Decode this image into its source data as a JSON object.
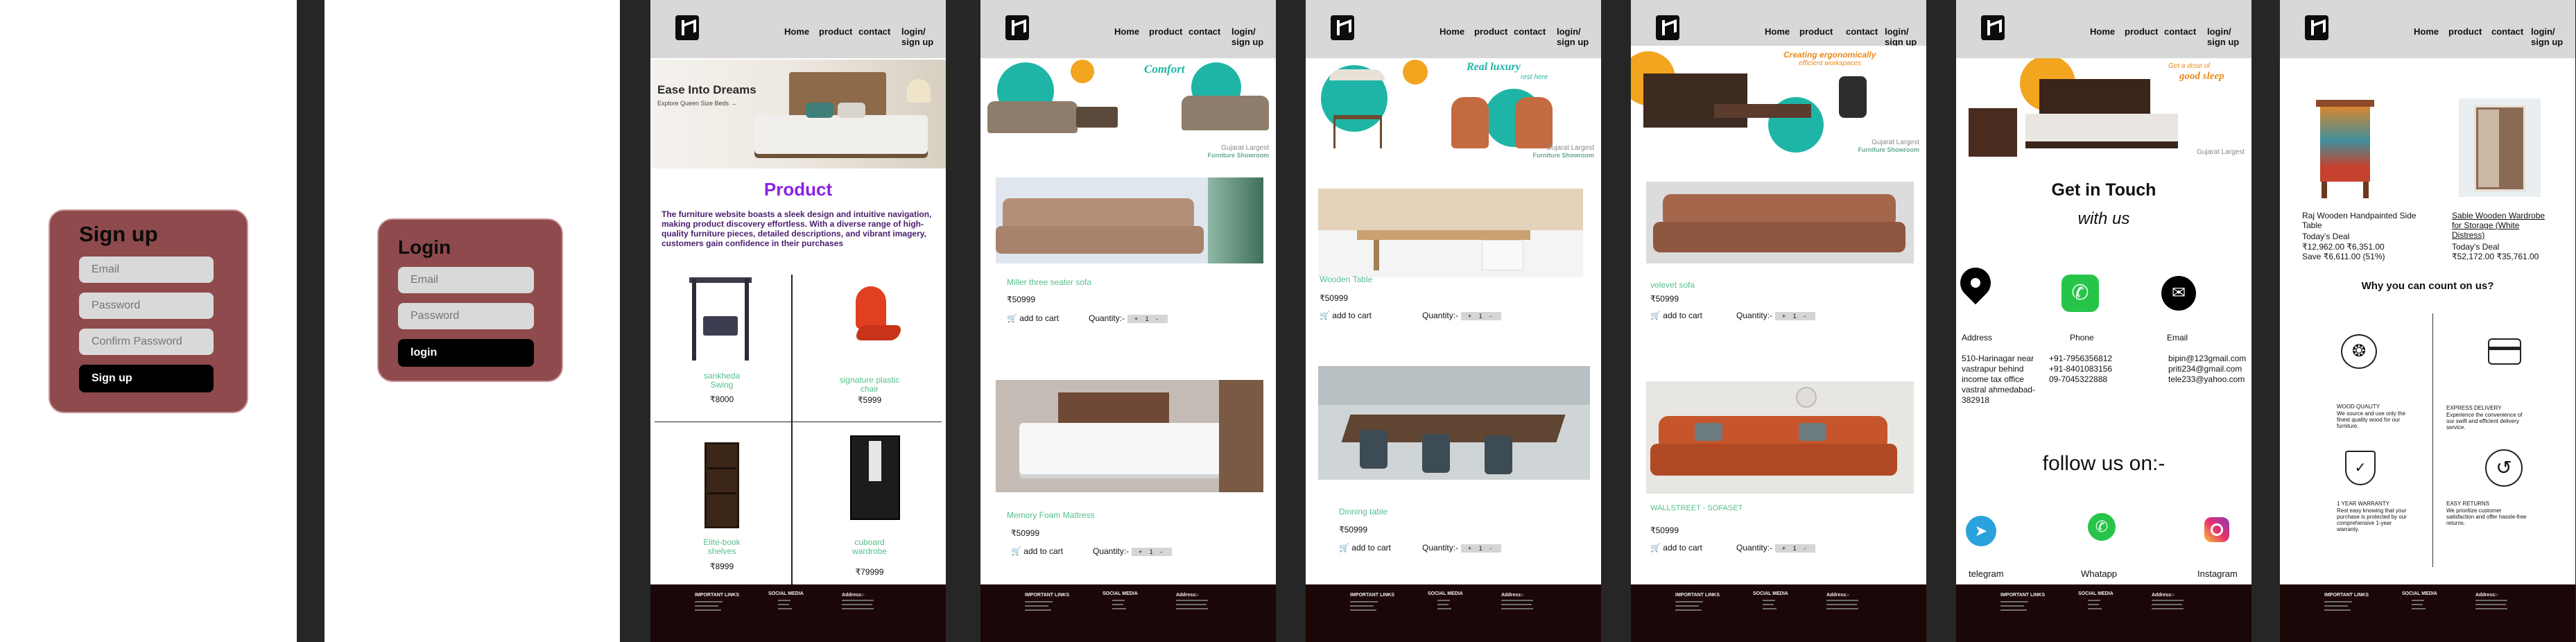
{
  "signup": {
    "title": "Sign up",
    "email_placeholder": "Email",
    "password_placeholder": "Password",
    "confirm_placeholder": "Confirm Password",
    "button": "Sign  up"
  },
  "login": {
    "title": "Login",
    "email_placeholder": "Email",
    "password_placeholder": "Password",
    "button": "login"
  },
  "nav": {
    "home": "Home",
    "product": "product",
    "contact": "contact",
    "login_1": "login/",
    "login_2": "sign up"
  },
  "footer": {
    "links": "IMPORTANT LINKS",
    "social": "SOCIAL MEDIA",
    "address": "Address:-"
  },
  "banners": {
    "hero": "Ease Into Dreams",
    "hero_sub": "Explore Queen Size Beds →",
    "comfort": "Comfort",
    "real_luxury": "Real luxury",
    "real_luxury_sub": "rest here",
    "workspace_1": "Creating ergonomically",
    "workspace_2": "efficient workspaces",
    "sleep_1": "Get a dose of",
    "sleep_2": "good sleep",
    "gujarat_1": "Gujarat Largest",
    "gujarat_2": "Furniture Showroom"
  },
  "product_page": {
    "heading": "Product",
    "description": "The furniture website boasts a sleek design and intuitive navigation, making product discovery effortless. With a diverse range of high-quality furniture pieces, detailed descriptions, and vibrant imagery, customers gain confidence in their purchases",
    "items": [
      {
        "name_1": "sankheda",
        "name_2": "Swing",
        "price": "₹8000"
      },
      {
        "name_1": "signature plastic",
        "name_2": "chair",
        "price": "₹5999"
      },
      {
        "name_1": "Elite-book",
        "name_2": "shelves",
        "price": "₹8999"
      },
      {
        "name_1": "cuboard",
        "name_2": "wardrobe",
        "price": "₹79999"
      }
    ]
  },
  "cart": {
    "add_label": "add to cart",
    "qty_label": "Quantity:-",
    "qty_controls": "+ 1 -"
  },
  "sofa_page": {
    "items": [
      {
        "name": "Miller three seater sofa",
        "price": "₹50999"
      },
      {
        "name": "Memory Foam Mattress",
        "price": "₹50999"
      }
    ]
  },
  "table_page": {
    "items": [
      {
        "name": "Wooden Table",
        "price": "₹50999"
      },
      {
        "name": "Dinning table",
        "price": "₹50999"
      }
    ]
  },
  "velvet_page": {
    "items": [
      {
        "name": "velevet sofa",
        "price": "₹50999"
      },
      {
        "name": "WALLSTREET - SOFASET",
        "price": "₹50999"
      }
    ]
  },
  "contact_page": {
    "title": "Get in Touch",
    "subtitle": "with us",
    "address_label": "Address",
    "phone_label": "Phone",
    "email_label": "Email",
    "address_text": "510-Harinagar near vastrapur behind income tax office vastral ahmedabad-382918",
    "phone_1": "+91-7956356812",
    "phone_2": "+91-8401083156",
    "phone_3": "09-7045322888",
    "email_1": "bipin@123gmail.com",
    "email_2": "priti234@gmail.com",
    "email_3": "tele233@yahoo.com",
    "follow": "follow us on:-",
    "telegram": "telegram",
    "whatsapp": "Whatapp",
    "instagram": "Instagram"
  },
  "detail_page": {
    "item1_name_1": "Raj Wooden Handpainted Side",
    "item1_name_2": "Table",
    "item1_deal": "Today's Deal",
    "item1_prices": "₹12,962.00 ₹6,351.00",
    "item1_save": "Save ₹6,611.00 (51%)",
    "item2_name_1": "Sable Wooden Wardrobe",
    "item2_name_2": "for Storage (White",
    "item2_name_3": "Distress)",
    "item2_deal": "Today's Deal",
    "item2_prices": "₹52,172.00 ₹35,761.00",
    "why_title": "Why you can count on us?",
    "f1_title": "WOOD QUALITY",
    "f1_text": "We source and use only the finest quality wood for our furniture.",
    "f2_title": "EXPRESS DELIVERY",
    "f2_text": "Experience the convenience of our swift and efficient delivery service.",
    "f3_title": "1 YEAR WARRANTY",
    "f3_text": "Rest easy knowing that your purchase is protected by our comprehensive 1-year warranty.",
    "f4_title": "EASY RETURNS",
    "f4_text": "We prioritize customer satisfaction and offer hassle-free returns."
  },
  "colors": {
    "card": "#8e4a4c",
    "footer": "#1b0608",
    "header": "#d8d8d8",
    "product_heading": "#8a22e6",
    "product_name": "#55bf8c",
    "teal": "#1fb5a6",
    "orange": "#f2a51f"
  }
}
